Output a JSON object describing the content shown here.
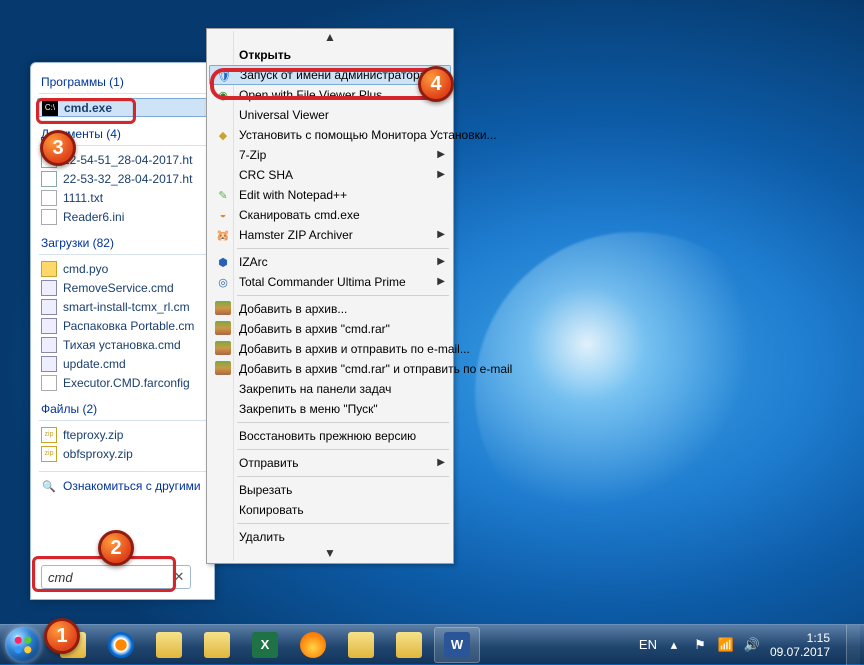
{
  "start": {
    "programs_header": "Программы (1)",
    "programs": [
      {
        "label": "cmd.exe",
        "icon": "ic-cmd"
      }
    ],
    "docs_header": "Документы (4)",
    "docs": [
      {
        "label": "22-54-51_28-04-2017.ht",
        "icon": "ic-doc"
      },
      {
        "label": "22-53-32_28-04-2017.ht",
        "icon": "ic-doc"
      },
      {
        "label": "1111.txt",
        "icon": "ic-txt"
      },
      {
        "label": "Reader6.ini",
        "icon": "ic-ini"
      }
    ],
    "downloads_header": "Загрузки (82)",
    "downloads": [
      {
        "label": "cmd.pyo",
        "icon": "ic-pyo"
      },
      {
        "label": "RemoveService.cmd",
        "icon": "ic-bat"
      },
      {
        "label": "smart-install-tcmx_rl.cm",
        "icon": "ic-bat"
      },
      {
        "label": "Распаковка Portable.cm",
        "icon": "ic-bat"
      },
      {
        "label": "Тихая установка.cmd",
        "icon": "ic-bat"
      },
      {
        "label": "update.cmd",
        "icon": "ic-bat"
      },
      {
        "label": "Executor.CMD.farconfig",
        "icon": "ic-txt"
      }
    ],
    "files_header": "Файлы (2)",
    "files": [
      {
        "label": "fteproxy.zip",
        "icon": "ic-zip"
      },
      {
        "label": "obfsproxy.zip",
        "icon": "ic-zip"
      }
    ],
    "more_label": "Ознакомиться с другими",
    "search_value": "cmd"
  },
  "ctx": {
    "open": "Открыть",
    "run_admin": "Запуск от имени администратора",
    "fvp": "Open with File Viewer Plus",
    "uv": "Universal Viewer",
    "monitor": "Установить с помощью Монитора Установки...",
    "sevenzip": "7-Zip",
    "crcsha": "CRC SHA",
    "npp": "Edit with Notepad++",
    "scan": "Сканировать cmd.exe",
    "hamster": "Hamster ZIP Archiver",
    "izarc": "IZArc",
    "tcup": "Total Commander Ultima Prime",
    "ar1": "Добавить в архив...",
    "ar2": "Добавить в архив \"cmd.rar\"",
    "ar3": "Добавить в архив и отправить по e-mail...",
    "ar4": "Добавить в архив \"cmd.rar\" и отправить по e-mail",
    "pin_tb": "Закрепить на панели задач",
    "pin_start": "Закрепить в меню \"Пуск\"",
    "restore": "Восстановить прежнюю версию",
    "send": "Отправить",
    "cut": "Вырезать",
    "copy": "Копировать",
    "del": "Удалить"
  },
  "tray": {
    "lang": "EN",
    "time": "1:15",
    "date": "09.07.2017"
  },
  "callouts": {
    "c1": "1",
    "c2": "2",
    "c3": "3",
    "c4": "4"
  }
}
